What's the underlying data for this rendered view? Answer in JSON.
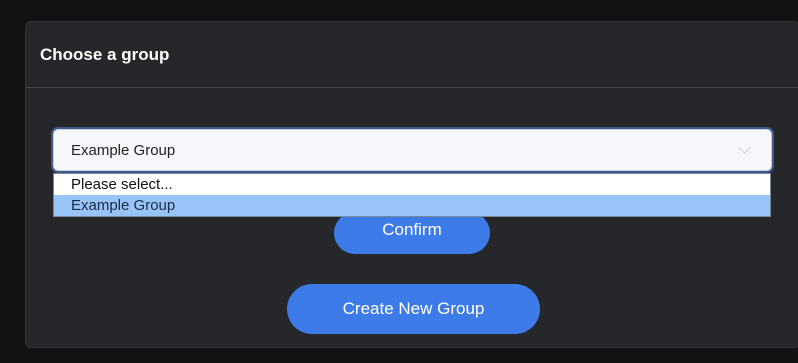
{
  "modal": {
    "title": "Choose a group"
  },
  "group_select": {
    "selected_value": "Example Group",
    "options": [
      {
        "label": "Please select...",
        "selected": false
      },
      {
        "label": "Example Group",
        "selected": true
      }
    ]
  },
  "buttons": {
    "confirm_label": "Confirm",
    "create_label": "Create New Group"
  },
  "colors": {
    "accent": "#3d7be8",
    "option_highlight": "#99c4f7",
    "modal_bg": "#25272a"
  }
}
